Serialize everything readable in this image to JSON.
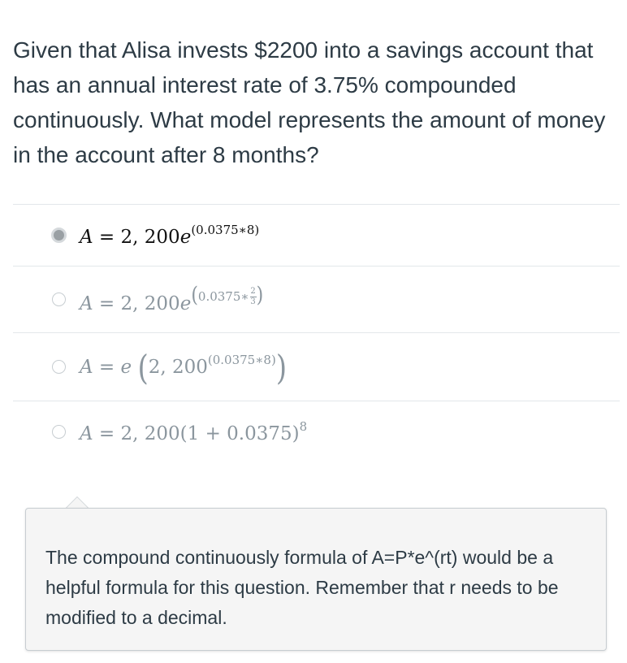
{
  "question": {
    "text": "Given that Alisa invests $2200 into a savings account that has an annual interest rate of 3.75% compounded continuously.  What model represents the amount of money in the account after 8 months?"
  },
  "answers": [
    {
      "selected": true,
      "lhs": "A",
      "eq": " = 2, 200",
      "base": "e",
      "exponent": "(0.0375∗8)"
    },
    {
      "selected": false,
      "lhs": "A",
      "eq": " = 2, 200",
      "base": "e",
      "exp_open": "(",
      "exp_text": "0.0375∗",
      "frac_num": "2",
      "frac_den": "3",
      "exp_close": ")"
    },
    {
      "selected": false,
      "lhs": "A",
      "eq": " = ",
      "base": "e",
      "open": "(",
      "inner": "2, 200",
      "exponent": "(0.0375∗8)",
      "close": ")"
    },
    {
      "selected": false,
      "lhs": "A",
      "eq": " = 2, 200(1 + 0.0375)",
      "exponent": "8"
    }
  ],
  "feedback": {
    "text": "The compound continuously formula of A=P*e^(rt) would be a helpful formula for this question. Remember that r needs to be modified to a decimal."
  },
  "colors": {
    "text": "#2d3b45",
    "muted_formula": "#8b969e",
    "divider": "#e3e7ea",
    "feedback_bg": "#f5f5f5",
    "radio_selected": "#9aa0a4"
  }
}
